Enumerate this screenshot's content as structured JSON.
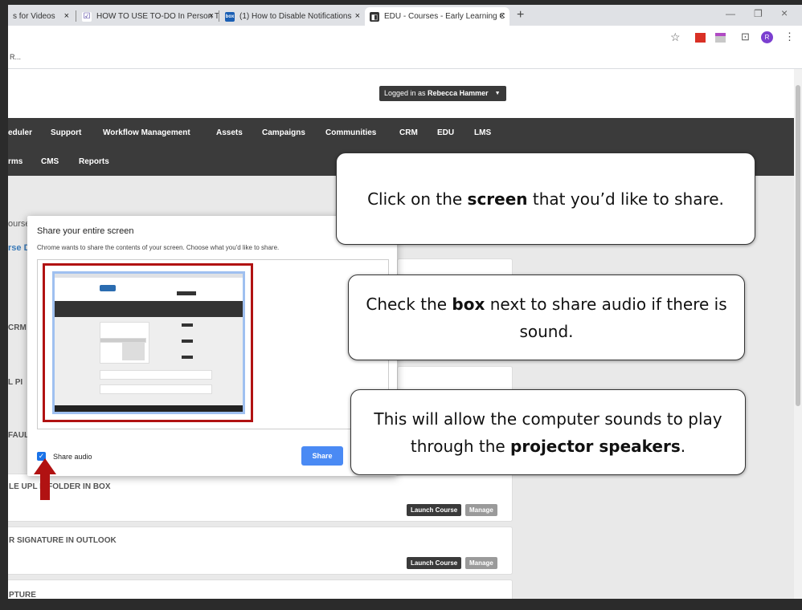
{
  "tabs": [
    {
      "label": "s for Videos",
      "favicon_color": "#ffffff"
    },
    {
      "label": "HOW TO USE TO-DO In Person T",
      "favicon_color": "#4b3c9e"
    },
    {
      "label": "(1) How to Disable Notifications",
      "favicon_color": "#1a5fb4"
    },
    {
      "label": "EDU - Courses - Early Learning C",
      "favicon_color": "#333333"
    }
  ],
  "tab_favicons": [
    "",
    "☑",
    "box",
    "◧"
  ],
  "tab_close": "×",
  "new_tab": "+",
  "window_controls": {
    "minimize": "—",
    "restore": "❐",
    "close": "×"
  },
  "toolbar": {
    "star": "☆",
    "avatar": "R",
    "menu": "⋮",
    "cast": "⊡"
  },
  "bookmarks_bar": "R...",
  "header": {
    "logged_in_prefix": "Logged in as ",
    "user_name": "Rebecca Hammer"
  },
  "nav_row1": [
    "eduler",
    "Support",
    "Workflow Management",
    "Assets",
    "Campaigns",
    "Communities",
    "CRM",
    "EDU",
    "LMS"
  ],
  "nav_row2": [
    "rms",
    "CMS",
    "Reports"
  ],
  "side_labels": {
    "courses": "ourse",
    "course_d": "rse D",
    "crm": "CRM",
    "pi": "L PI",
    "fault": "FAUL"
  },
  "courses": [
    {
      "title": "LE UPL    D FOLDER IN BOX",
      "launch": "Launch Course",
      "manage": "Manage"
    },
    {
      "title": "R SIGNATURE IN OUTLOOK",
      "launch": "Launch Course",
      "manage": "Manage"
    },
    {
      "title": "PTURE"
    }
  ],
  "dialog": {
    "title": "Share your entire screen",
    "subtitle": "Chrome wants to share the contents of your screen. Choose what you'd like to share.",
    "share_audio_label": "Share audio",
    "share_audio_checked": true,
    "checkmark": "✓",
    "share_button": "Share"
  },
  "callouts": {
    "c1_a": "Click on the ",
    "c1_b": "screen",
    "c1_c": " that you’d like to share.",
    "c2_a": "Check the ",
    "c2_b": "box",
    "c2_c": " next to share audio if there is sound.",
    "c3_a": "This will allow the computer sounds to play through the ",
    "c3_b": "projector speakers",
    "c3_c": "."
  },
  "colors": {
    "accent_red": "#b11212",
    "share_blue": "#4a8af4",
    "nav_dark": "#3b3b3b"
  }
}
